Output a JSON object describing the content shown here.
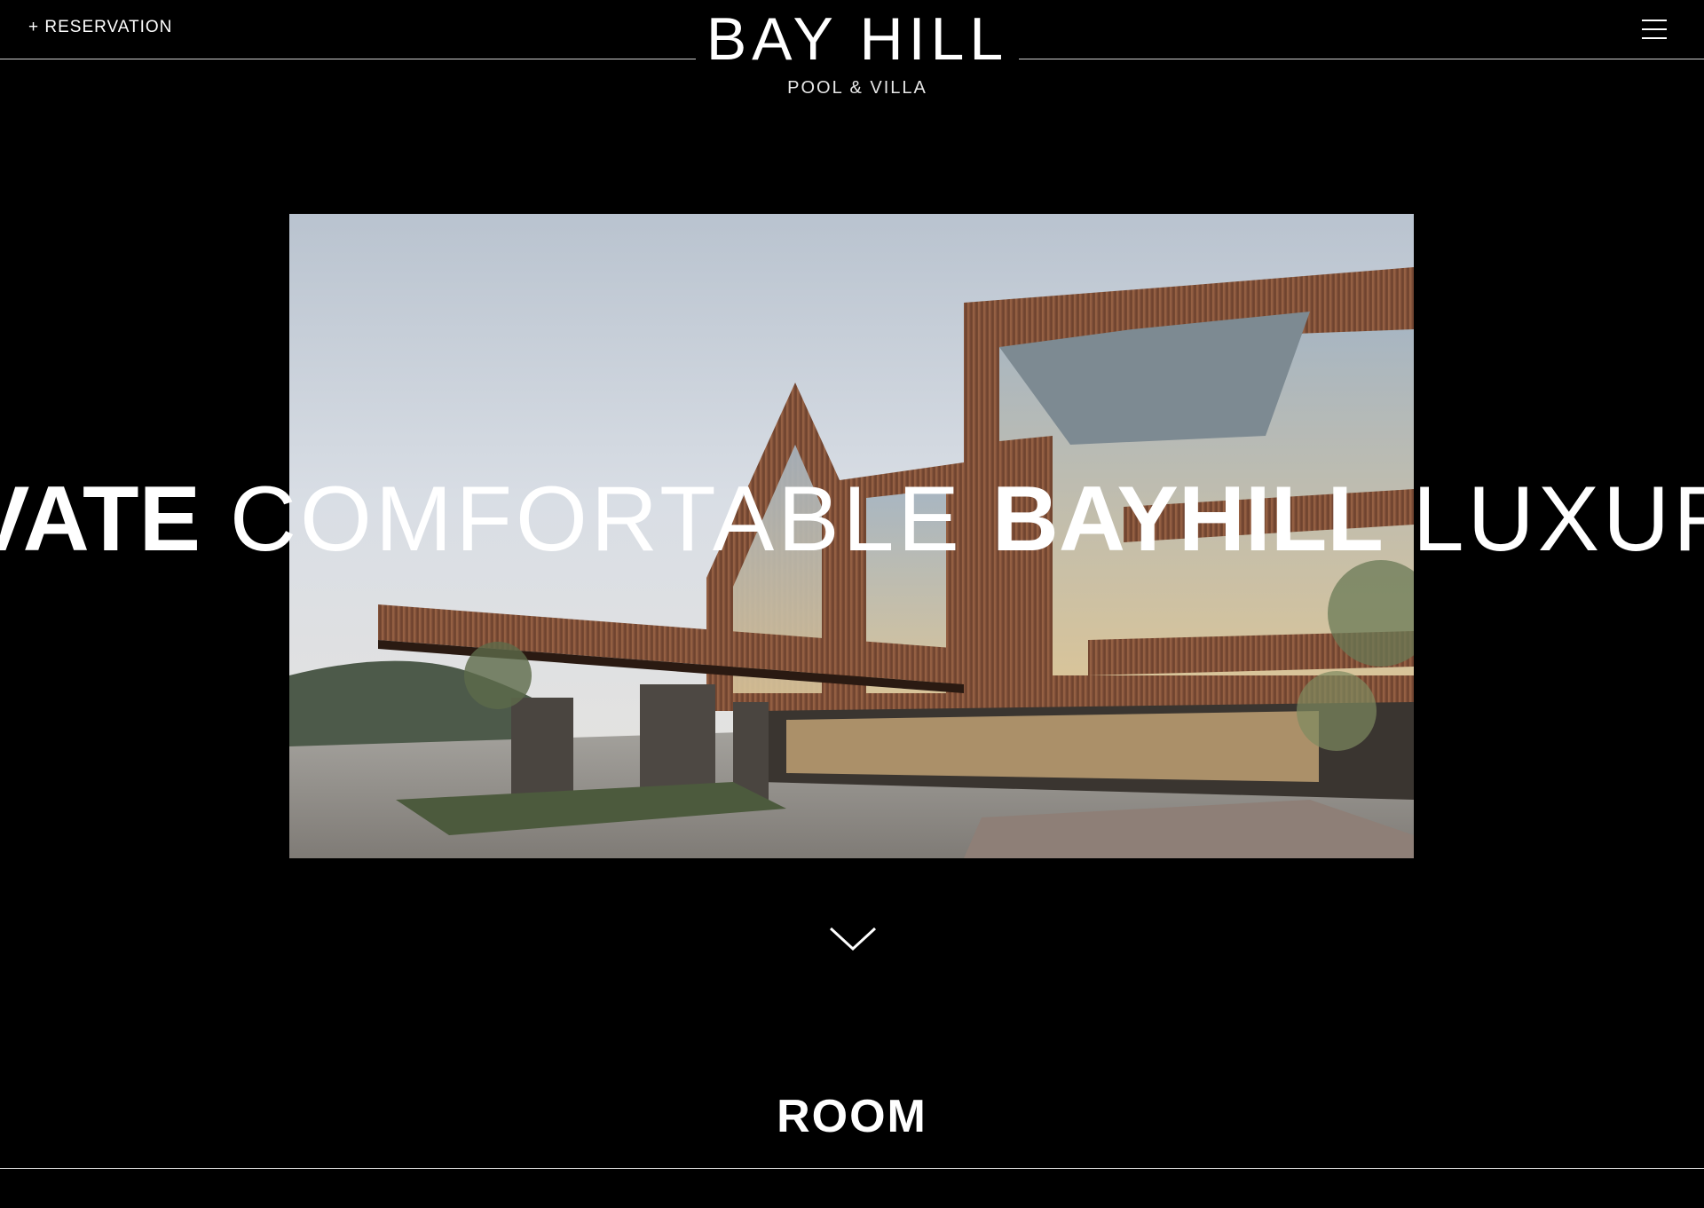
{
  "header": {
    "reservation_label": "+ RESERVATION",
    "logo_title": "BAY HILL",
    "logo_subtitle": "POOL & VILLA",
    "menu_icon": "hamburger-menu-icon"
  },
  "hero": {
    "image_alt": "Bay Hill Pool & Villa building exterior at dusk",
    "marquee": [
      {
        "text": "VATE",
        "style": "bold"
      },
      {
        "text": "COMFORTABLE",
        "style": "light"
      },
      {
        "text": "BAYHILL",
        "style": "bold"
      },
      {
        "text": "LUXURY",
        "style": "light"
      }
    ]
  },
  "scroll": {
    "icon": "chevron-down-icon"
  },
  "room": {
    "title": "ROOM"
  },
  "colors": {
    "background": "#000000",
    "text": "#ffffff",
    "line": "#cfcfcf"
  }
}
